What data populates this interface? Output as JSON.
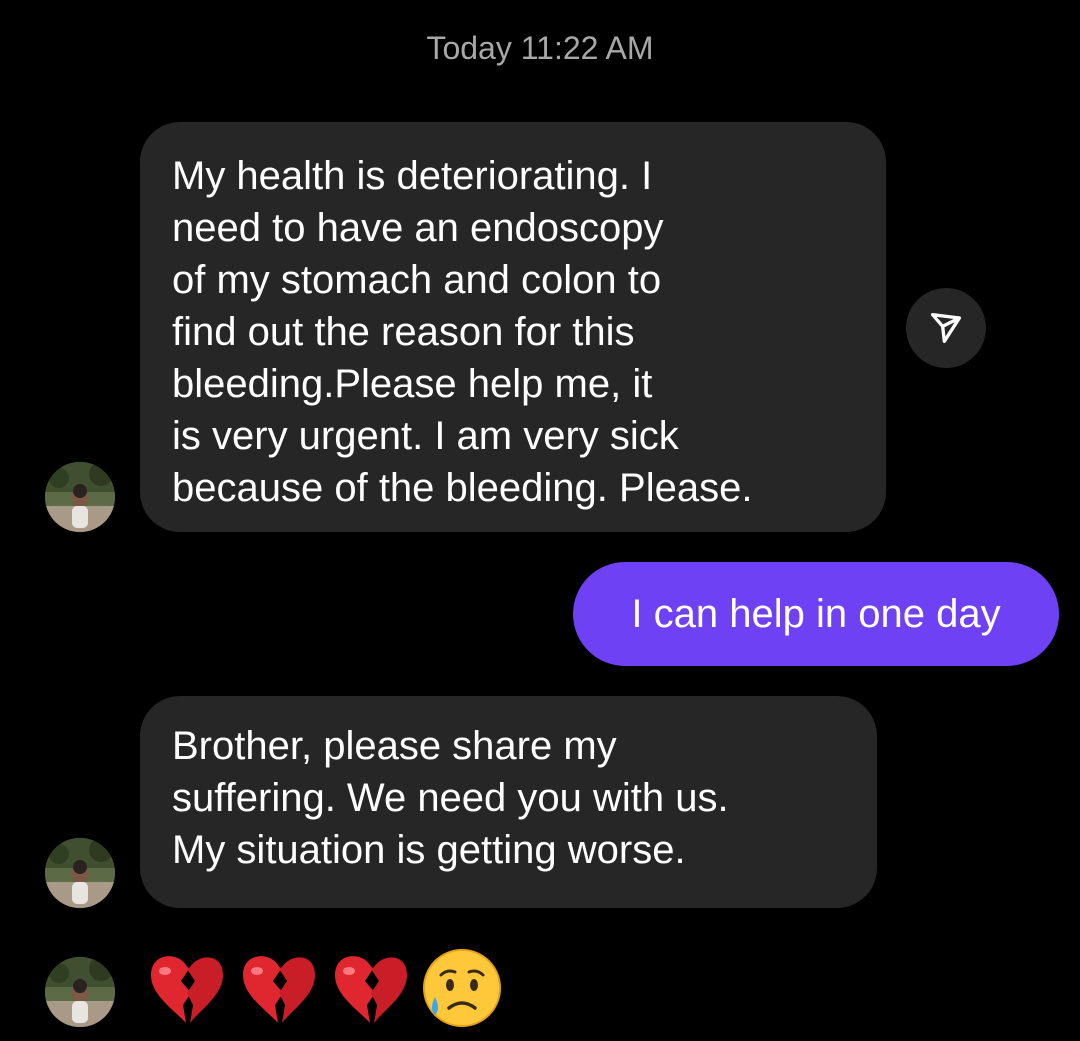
{
  "thread": {
    "timestamp": "Today 11:22 AM"
  },
  "messages": [
    {
      "sender": "other",
      "text": "My health is deteriorating. I\nneed to have an endoscopy\nof my stomach and colon to\nfind out the reason for this\nbleeding.Please help me, it\nis very urgent. I am very sick\nbecause of the bleeding. Please."
    },
    {
      "sender": "me",
      "text": "I can help in one day"
    },
    {
      "sender": "other",
      "text": "Brother, please share my\nsuffering. We need you with us.\nMy situation is getting worse."
    },
    {
      "sender": "other",
      "emojis": [
        "broken-heart",
        "broken-heart",
        "broken-heart",
        "sad-but-relieved-face"
      ]
    }
  ],
  "colors": {
    "background": "#000000",
    "received_bubble": "#262626",
    "sent_bubble": "#6f41f5",
    "timestamp_text": "#a8a8a8"
  },
  "icons": {
    "share": "send-icon"
  }
}
